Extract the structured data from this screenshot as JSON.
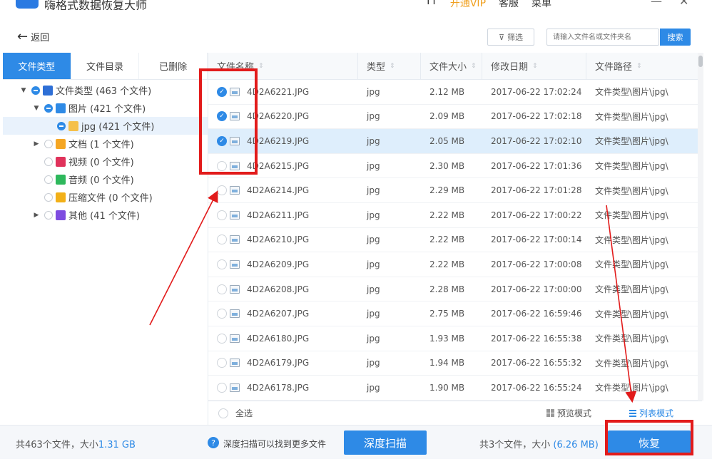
{
  "app": {
    "title": "嗨格式数据恢复大师",
    "header_right": [
      "TT",
      "开通VIP",
      "客服",
      "菜单"
    ],
    "minimize": "—",
    "close": "✕"
  },
  "toolbar": {
    "back_label": "返回",
    "filter_label": "筛选",
    "search_placeholder": "请输入文件名或文件夹名",
    "search_button": "搜索"
  },
  "sidebar": {
    "tabs": [
      "文件类型",
      "文件目录",
      "已删除"
    ],
    "tree": [
      {
        "label": "文件类型 (463 个文件)",
        "icon_color": "#2e6fd6",
        "icon": "folder-type-icon",
        "expanded": true
      },
      {
        "label": "图片 (421 个文件)",
        "icon_color": "#2e8ae6",
        "icon": "image-icon",
        "expanded": true
      },
      {
        "label": "jpg (421 个文件)",
        "icon_color": "#f5c04a",
        "icon": "folder-icon"
      },
      {
        "label": "文档 (1 个文件)",
        "icon_color": "#f5a623",
        "icon": "document-icon",
        "expanded": false
      },
      {
        "label": "视频 (0 个文件)",
        "icon_color": "#e0325b",
        "icon": "video-icon"
      },
      {
        "label": "音频 (0 个文件)",
        "icon_color": "#2eb85c",
        "icon": "audio-icon"
      },
      {
        "label": "压缩文件 (0 个文件)",
        "icon_color": "#f2b018",
        "icon": "archive-icon"
      },
      {
        "label": "其他 (41 个文件)",
        "icon_color": "#7e4ce0",
        "icon": "other-icon",
        "expanded": false
      }
    ]
  },
  "table": {
    "columns": [
      "文件名称",
      "类型",
      "文件大小",
      "修改日期",
      "文件路径"
    ],
    "rows": [
      {
        "name": "4D2A6221.JPG",
        "type": "jpg",
        "size": "2.12 MB",
        "date": "2017-06-22 17:02:24",
        "path": "文件类型\\图片\\jpg\\",
        "checked": true
      },
      {
        "name": "4D2A6220.JPG",
        "type": "jpg",
        "size": "2.09 MB",
        "date": "2017-06-22 17:02:18",
        "path": "文件类型\\图片\\jpg\\",
        "checked": true
      },
      {
        "name": "4D2A6219.JPG",
        "type": "jpg",
        "size": "2.05 MB",
        "date": "2017-06-22 17:02:10",
        "path": "文件类型\\图片\\jpg\\",
        "checked": true
      },
      {
        "name": "4D2A6215.JPG",
        "type": "jpg",
        "size": "2.30 MB",
        "date": "2017-06-22 17:01:36",
        "path": "文件类型\\图片\\jpg\\",
        "checked": false
      },
      {
        "name": "4D2A6214.JPG",
        "type": "jpg",
        "size": "2.29 MB",
        "date": "2017-06-22 17:01:28",
        "path": "文件类型\\图片\\jpg\\",
        "checked": false
      },
      {
        "name": "4D2A6211.JPG",
        "type": "jpg",
        "size": "2.22 MB",
        "date": "2017-06-22 17:00:22",
        "path": "文件类型\\图片\\jpg\\",
        "checked": false
      },
      {
        "name": "4D2A6210.JPG",
        "type": "jpg",
        "size": "2.22 MB",
        "date": "2017-06-22 17:00:14",
        "path": "文件类型\\图片\\jpg\\",
        "checked": false
      },
      {
        "name": "4D2A6209.JPG",
        "type": "jpg",
        "size": "2.22 MB",
        "date": "2017-06-22 17:00:08",
        "path": "文件类型\\图片\\jpg\\",
        "checked": false
      },
      {
        "name": "4D2A6208.JPG",
        "type": "jpg",
        "size": "2.28 MB",
        "date": "2017-06-22 17:00:00",
        "path": "文件类型\\图片\\jpg\\",
        "checked": false
      },
      {
        "name": "4D2A6207.JPG",
        "type": "jpg",
        "size": "2.75 MB",
        "date": "2017-06-22 16:59:46",
        "path": "文件类型\\图片\\jpg\\",
        "checked": false
      },
      {
        "name": "4D2A6180.JPG",
        "type": "jpg",
        "size": "1.93 MB",
        "date": "2017-06-22 16:55:38",
        "path": "文件类型\\图片\\jpg\\",
        "checked": false
      },
      {
        "name": "4D2A6179.JPG",
        "type": "jpg",
        "size": "1.94 MB",
        "date": "2017-06-22 16:55:32",
        "path": "文件类型\\图片\\jpg\\",
        "checked": false
      },
      {
        "name": "4D2A6178.JPG",
        "type": "jpg",
        "size": "1.90 MB",
        "date": "2017-06-22 16:55:24",
        "path": "文件类型\\图片\\jpg\\",
        "checked": false
      }
    ],
    "select_all": "全选",
    "preview_mode": "预览模式",
    "list_mode": "列表模式"
  },
  "status": {
    "total_prefix": "共463个文件，大小",
    "total_size": "1.31 GB",
    "deep_scan_hint": "深度扫描可以找到更多文件",
    "deep_scan_button": "深度扫描",
    "selected_prefix": "共3个文件，大小",
    "selected_size": "(6.26 MB)",
    "recover_button": "恢复"
  },
  "colors": {
    "accent": "#2e8ae6",
    "annotation": "#e21b1b",
    "highlight_row": "#deeefc"
  }
}
